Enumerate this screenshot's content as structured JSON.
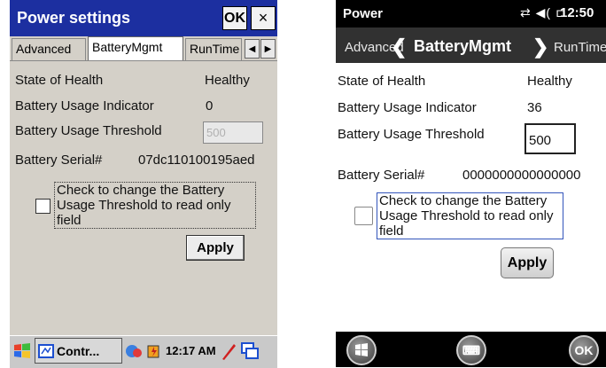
{
  "left": {
    "title": "Power settings",
    "ok_label": "OK",
    "close_glyph": "×",
    "tabs": [
      "Advanced",
      "BatteryMgmt",
      "RunTime"
    ],
    "arrow_left": "◀",
    "arrow_right": "▶",
    "state_label": "State of Health",
    "state_value": "Healthy",
    "indicator_label": "Battery Usage Indicator",
    "indicator_value": "0",
    "threshold_label": "Battery Usage Threshold",
    "threshold_value": "500",
    "serial_label": "Battery Serial#",
    "serial_value": "07dc110100195aed",
    "checkbox_label": "Check to change the Battery Usage Threshold to read only field",
    "apply_label": "Apply",
    "taskbar": {
      "start_glyph": "⊞",
      "task_label": "Contr...",
      "time": "12:17 AM",
      "tray_icons": [
        "network-icon",
        "battery-icon",
        "pen-icon",
        "window-switch-icon"
      ]
    }
  },
  "right": {
    "status_title": "Power",
    "status_icons": "⇄ ◀( ⊏",
    "time": "12:50",
    "tabs": [
      "Advanced",
      "BatteryMgmt",
      "RunTime"
    ],
    "chev_left": "❮",
    "chev_right": "❯",
    "state_label": "State of Health",
    "state_value": "Healthy",
    "indicator_label": "Battery Usage Indicator",
    "indicator_value": "36",
    "threshold_label": "Battery Usage Threshold",
    "threshold_value": "500",
    "serial_label": "Battery Serial#",
    "serial_value": "0000000000000000",
    "checkbox_label": "Check to change the Battery Usage Threshold to read only field",
    "apply_label": "Apply",
    "nav": {
      "start_glyph": "⊞",
      "keyboard_glyph": "⌨",
      "ok_label": "OK"
    }
  }
}
